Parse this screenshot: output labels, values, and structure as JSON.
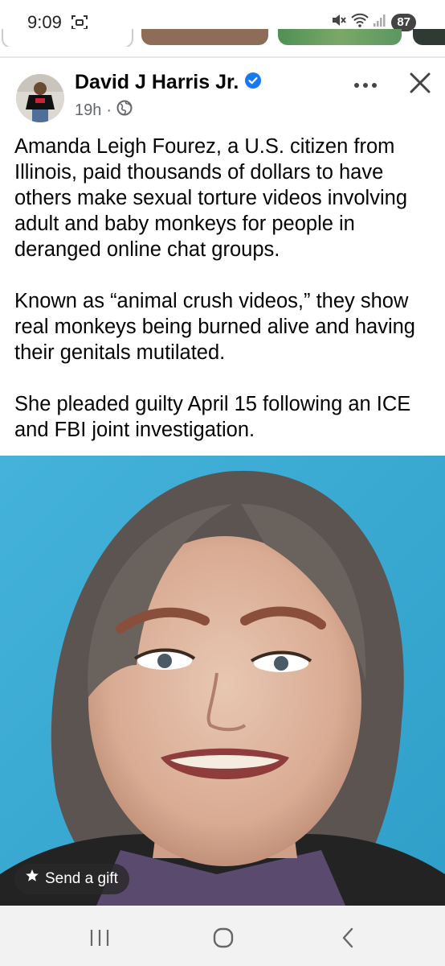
{
  "status_bar": {
    "time": "9:09",
    "battery": "87",
    "icons": [
      "screen-record-icon",
      "mute-icon",
      "wifi-icon",
      "signal-icon"
    ]
  },
  "post": {
    "author": "David J Harris Jr.",
    "verified": true,
    "time_ago": "19h",
    "dot": "·",
    "audience_icon": "globe-icon",
    "paragraphs": [
      "Amanda Leigh Fourez, a U.S. citizen from Illinois, paid thousands of dollars to have others make sexual torture videos involving adult and baby monkeys for people in deranged online chat groups.",
      "Known as “animal crush videos,” they show real monkeys being burned alive and having their genitals mutilated.",
      "She pleaded guilty April 15 following an ICE and FBI joint investigation."
    ]
  },
  "photo": {
    "gift_label": "Send a gift"
  },
  "nav_bar": {
    "buttons": [
      "recents-icon",
      "home-icon",
      "back-icon"
    ]
  },
  "colors": {
    "accent_blue": "#1877f2",
    "meta_gray": "#65676b",
    "photo_background": "#3aa9d2"
  }
}
